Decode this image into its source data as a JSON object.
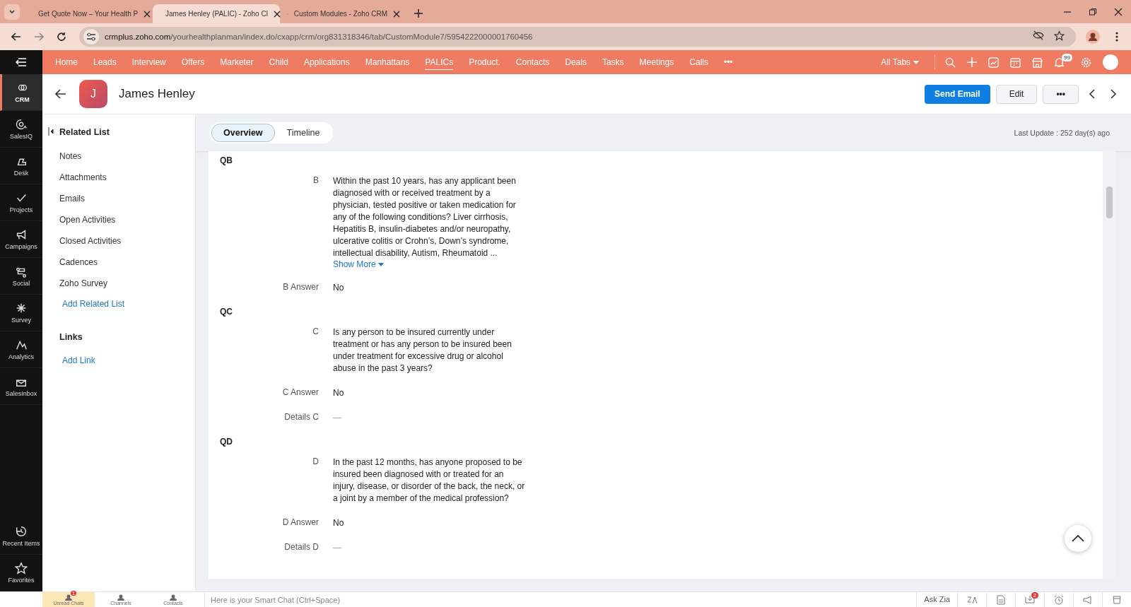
{
  "browser": {
    "tabs": [
      {
        "title": "Get Quote Now – Your Health P",
        "selected": false
      },
      {
        "title": "James Henley (PALIC) - Zoho Cl",
        "selected": true
      },
      {
        "title": "Custom Modules - Zoho CRM",
        "selected": false
      }
    ],
    "url_host": "crmplus.zoho.com",
    "url_path": "/yourhealthplanman/index.do/cxapp/crm/org831318346/tab/CustomModule7/5954222000001760456"
  },
  "app_sidebar": {
    "items": [
      {
        "label": "CRM",
        "selected": true
      },
      {
        "label": "SalesIQ",
        "selected": false
      },
      {
        "label": "Desk",
        "selected": false
      },
      {
        "label": "Projects",
        "selected": false
      },
      {
        "label": "Campaigns",
        "selected": false
      },
      {
        "label": "Social",
        "selected": false
      },
      {
        "label": "Survey",
        "selected": false
      },
      {
        "label": "Analytics",
        "selected": false
      },
      {
        "label": "SalesInbox",
        "selected": false
      }
    ],
    "bottom_items": [
      "Recent Items",
      "Favorites"
    ]
  },
  "nav": {
    "tabs": [
      {
        "label": "Home",
        "selected": false
      },
      {
        "label": "Leads",
        "selected": false
      },
      {
        "label": "Interview",
        "selected": false
      },
      {
        "label": "Offers",
        "selected": false
      },
      {
        "label": "Marketer",
        "selected": false
      },
      {
        "label": "Child",
        "selected": false
      },
      {
        "label": "Applications",
        "selected": false
      },
      {
        "label": "Manhattans",
        "selected": false
      },
      {
        "label": "PALICs",
        "selected": true
      },
      {
        "label": "Product.",
        "selected": false
      },
      {
        "label": "Contacts",
        "selected": false
      },
      {
        "label": "Deals",
        "selected": false
      },
      {
        "label": "Tasks",
        "selected": false
      },
      {
        "label": "Meetings",
        "selected": false
      },
      {
        "label": "Calls",
        "selected": false
      }
    ],
    "more": "•••",
    "all_tabs": "All Tabs",
    "notification_count": "99"
  },
  "record": {
    "initial": "J",
    "name": "James Henley",
    "buttons": {
      "primary": "Send Email",
      "edit": "Edit",
      "more": "•••"
    }
  },
  "related": {
    "title": "Related List",
    "items": [
      "Notes",
      "Attachments",
      "Emails",
      "Open Activities",
      "Closed Activities",
      "Cadences",
      "Zoho Survey"
    ],
    "add": "Add Related List",
    "links_title": "Links",
    "add_link": "Add Link"
  },
  "view_tabs": [
    {
      "label": "Overview",
      "selected": true
    },
    {
      "label": "Timeline",
      "selected": false
    }
  ],
  "last_update": "Last Update : 252 day(s) ago",
  "sections": [
    {
      "title": "QB",
      "fields": [
        {
          "label": "B",
          "value": "Within the past 10 years, has any applicant been diagnosed with or received treatment by a physician, tested positive or taken medication for any of the following conditions? Liver cirrhosis, Hepatitis B, insulin-diabetes and/or neuropathy, ulcerative colitis or Crohn’s, Down’s syndrome, intellectual disability, Autism, Rheumatoid ...",
          "kind": "question",
          "more": "Show More"
        },
        {
          "label": "B Answer",
          "value": "No",
          "kind": "value"
        }
      ]
    },
    {
      "title": "QC",
      "fields": [
        {
          "label": "C",
          "value": "Is any person to be insured currently under treatment or has any person to be insured been under treatment for excessive drug or alcohol abuse in the past 3 years?",
          "kind": "question"
        },
        {
          "label": "C Answer",
          "value": "No",
          "kind": "value"
        },
        {
          "label": "Details C",
          "value": "—",
          "kind": "empty"
        }
      ]
    },
    {
      "title": "QD",
      "fields": [
        {
          "label": "D",
          "value": "In the past 12 months, has anyone proposed to be insured been diagnosed with or treated for an injury, disease, or disorder of the back, the neck, or a joint by a member of the medical profession?",
          "kind": "question"
        },
        {
          "label": "D Answer",
          "value": "No",
          "kind": "value"
        },
        {
          "label": "Details D",
          "value": "—",
          "kind": "empty"
        }
      ]
    }
  ],
  "bottom_bar": {
    "chat_tabs": [
      {
        "label": "Unread Chats",
        "selected": true,
        "badge": "1"
      },
      {
        "label": "Channels",
        "selected": false
      },
      {
        "label": "Contacts",
        "selected": false
      }
    ],
    "placeholder": "Here is your Smart Chat (Ctrl+Space)",
    "ask_zia": "Ask Zia",
    "download_badge": "2"
  }
}
